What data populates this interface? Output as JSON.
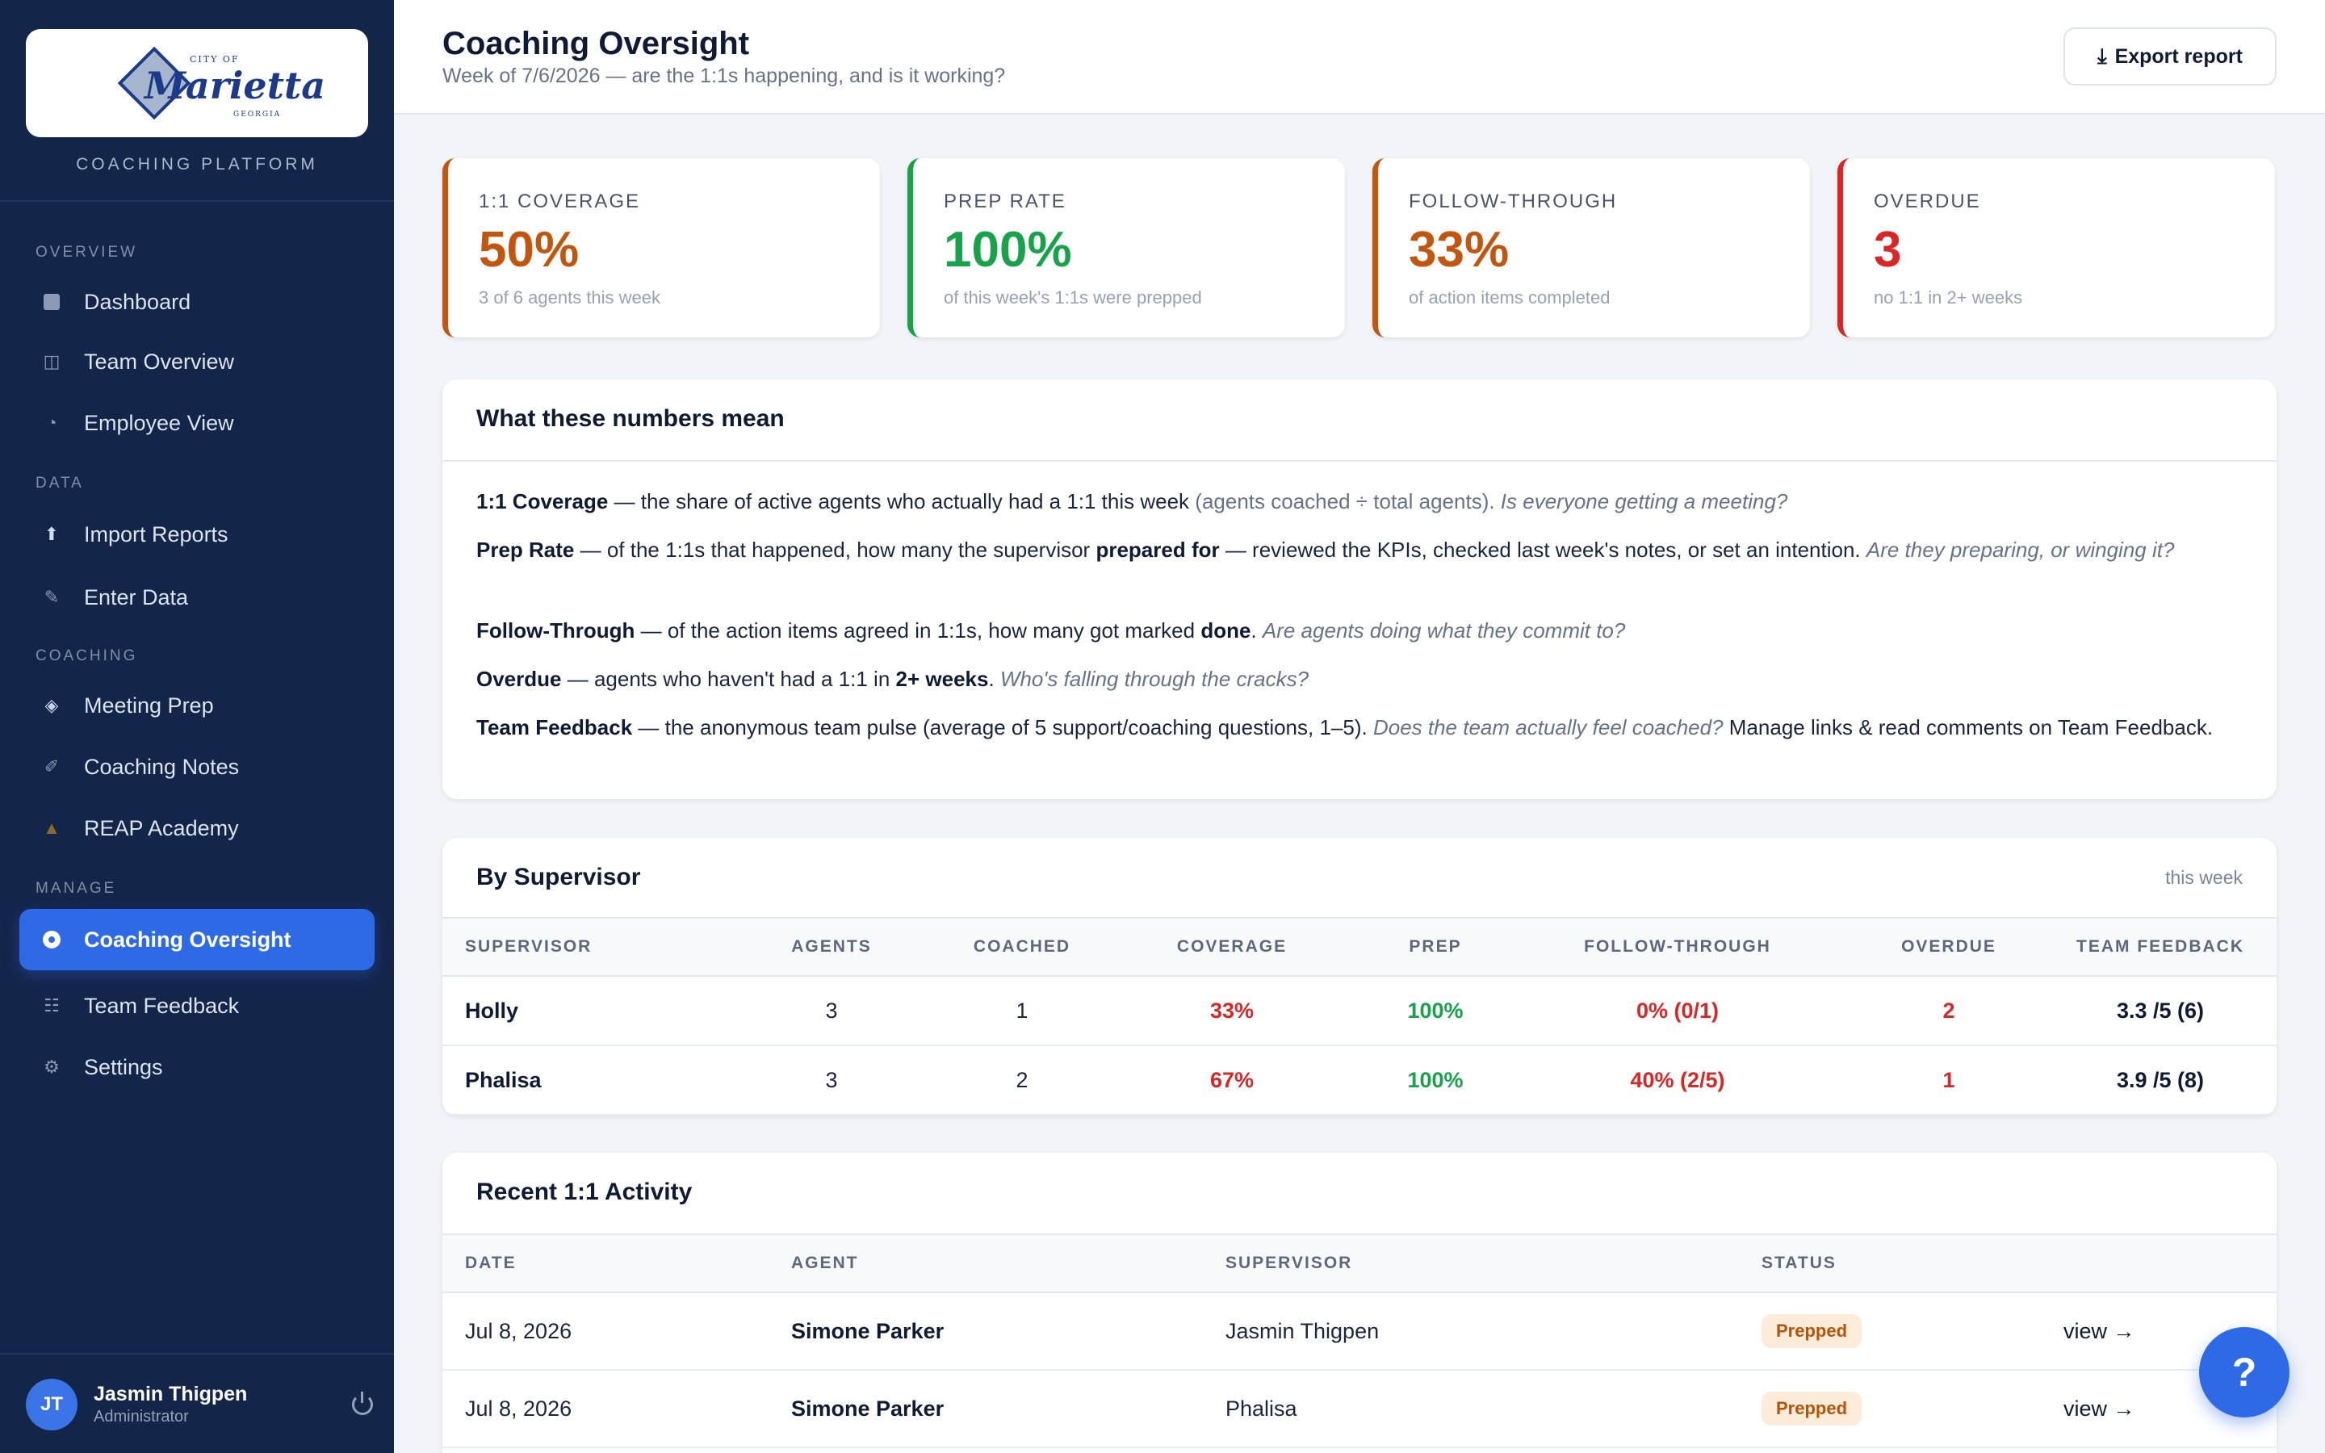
{
  "sidebar": {
    "logo": {
      "text": "Marietta",
      "small_top": "CITY OF",
      "small_bottom": "GEORGIA"
    },
    "platform_label": "COACHING PLATFORM",
    "sections": {
      "overview": "OVERVIEW",
      "data": "DATA",
      "coaching": "COACHING",
      "manage": "MANAGE"
    },
    "items": [
      {
        "label": "Dashboard",
        "icon": "square-icon"
      },
      {
        "label": "Team Overview",
        "icon": "columns-icon"
      },
      {
        "label": "Employee View",
        "icon": "pie-icon"
      },
      {
        "label": "Import Reports",
        "icon": "upload-arrow-icon"
      },
      {
        "label": "Enter Data",
        "icon": "pencil-icon"
      },
      {
        "label": "Meeting Prep",
        "icon": "diamond-icon"
      },
      {
        "label": "Coaching Notes",
        "icon": "pen-icon"
      },
      {
        "label": "REAP Academy",
        "icon": "graduation-cap-icon"
      },
      {
        "label": "Coaching Oversight",
        "icon": "target-icon",
        "active": true
      },
      {
        "label": "Team Feedback",
        "icon": "list-icon"
      },
      {
        "label": "Settings",
        "icon": "gear-icon"
      }
    ],
    "user": {
      "initials": "JT",
      "name": "Jasmin Thigpen",
      "role": "Administrator"
    }
  },
  "header": {
    "title": "Coaching Oversight",
    "subtitle": "Week of 7/6/2026 — are the 1:1s happening, and is it working?",
    "export_label": "Export report"
  },
  "kpis": [
    {
      "label": "1:1 COVERAGE",
      "value": "50%",
      "caption": "3 of 6 agents this week",
      "color": "#c2560f"
    },
    {
      "label": "PREP RATE",
      "value": "100%",
      "caption": "of this week's 1:1s were prepped",
      "color": "#16a34a"
    },
    {
      "label": "FOLLOW-THROUGH",
      "value": "33%",
      "caption": "of action items completed",
      "color": "#c2560f"
    },
    {
      "label": "OVERDUE",
      "value": "3",
      "caption": "no 1:1 in 2+ weeks",
      "color": "#dc2626"
    }
  ],
  "meaning": {
    "title": "What these numbers mean",
    "coverage": {
      "term": "1:1 Coverage",
      "text": " — the share of active agents who actually had a 1:1 this week ",
      "paren": "(agents coached ÷ total agents).",
      "question": " Is everyone getting a meeting?"
    },
    "prep": {
      "term": "Prep Rate",
      "text1": " — of the 1:1s that happened, how many the supervisor ",
      "bold": "prepared for",
      "text2": " — reviewed the KPIs, checked last week's notes, or set an intention. ",
      "question": "Are they preparing, or winging it?"
    },
    "follow": {
      "term": "Follow-Through",
      "text1": " — of the action items agreed in 1:1s, how many got marked ",
      "bold": "done",
      "text2": ". ",
      "question": "Are agents doing what they commit to?"
    },
    "overdue": {
      "term": "Overdue",
      "text1": " — agents who haven't had a 1:1 in ",
      "bold": "2+ weeks",
      "text2": ". ",
      "question": "Who's falling through the cracks?"
    },
    "feedback": {
      "term": "Team Feedback",
      "text1": " — the anonymous team pulse (average of 5 support/coaching questions, 1–5). ",
      "question": "Does the team actually feel coached?",
      "text2": " Manage links & read comments on Team Feedback."
    }
  },
  "by_supervisor": {
    "title": "By Supervisor",
    "period": "this week",
    "columns": [
      "SUPERVISOR",
      "AGENTS",
      "COACHED",
      "COVERAGE",
      "PREP",
      "FOLLOW-THROUGH",
      "OVERDUE",
      "TEAM FEEDBACK"
    ],
    "rows": [
      {
        "supervisor": "Holly",
        "agents": "3",
        "coached": "1",
        "coverage": "33%",
        "prep": "100%",
        "follow": "0% (0/1)",
        "overdue": "2",
        "feedback": "3.3 /5 (6)"
      },
      {
        "supervisor": "Phalisa",
        "agents": "3",
        "coached": "2",
        "coverage": "67%",
        "prep": "100%",
        "follow": "40% (2/5)",
        "overdue": "1",
        "feedback": "3.9 /5 (8)"
      }
    ]
  },
  "recent": {
    "title": "Recent 1:1 Activity",
    "columns": [
      "DATE",
      "AGENT",
      "SUPERVISOR",
      "STATUS"
    ],
    "rows": [
      {
        "date": "Jul 8, 2026",
        "agent": "Simone Parker",
        "supervisor": "Jasmin Thigpen",
        "status": "Prepped",
        "action": "view →"
      },
      {
        "date": "Jul 8, 2026",
        "agent": "Simone Parker",
        "supervisor": "Phalisa",
        "status": "Prepped",
        "action": "view →"
      }
    ]
  },
  "help_label": "?"
}
